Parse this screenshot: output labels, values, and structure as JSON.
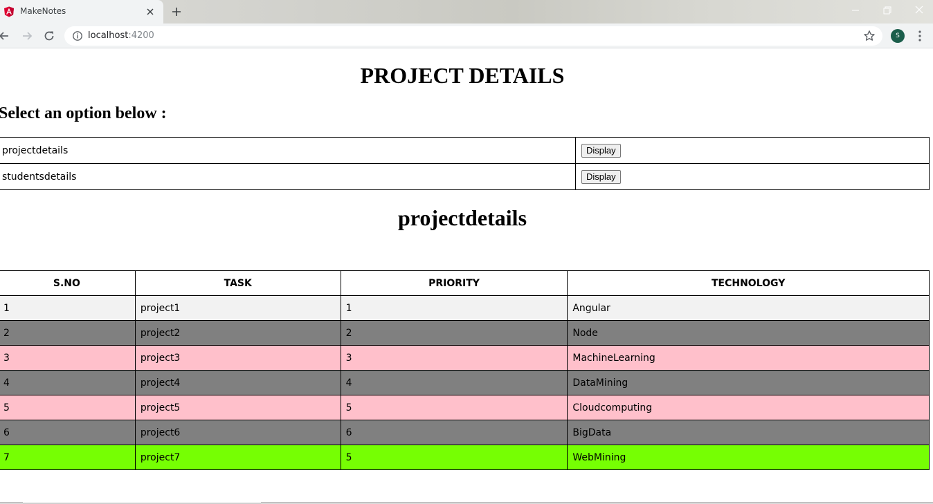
{
  "browser": {
    "tab_title": "MakeNotes",
    "url_host": "localhost",
    "url_port": ":4200",
    "profile_initial": "S"
  },
  "page": {
    "title": "PROJECT DETAILS",
    "select_heading": "Select an option below :",
    "options": [
      {
        "name": "projectdetails",
        "button_label": "Display"
      },
      {
        "name": "studentsdetails",
        "button_label": "Display"
      }
    ],
    "section_title": "projectdetails"
  },
  "table": {
    "headers": [
      "S.NO",
      "TASK",
      "PRIORITY",
      "TECHNOLOGY"
    ],
    "rows": [
      {
        "sno": "1",
        "task": "project1",
        "priority": "1",
        "technology": "Angular",
        "bg": "#f2f2f2"
      },
      {
        "sno": "2",
        "task": "project2",
        "priority": "2",
        "technology": "Node",
        "bg": "#808080"
      },
      {
        "sno": "3",
        "task": "project3",
        "priority": "3",
        "technology": "MachineLearning",
        "bg": "#ffc0cb"
      },
      {
        "sno": "4",
        "task": "project4",
        "priority": "4",
        "technology": "DataMining",
        "bg": "#808080"
      },
      {
        "sno": "5",
        "task": "project5",
        "priority": "5",
        "technology": "Cloudcomputing",
        "bg": "#ffc0cb"
      },
      {
        "sno": "6",
        "task": "project6",
        "priority": "6",
        "technology": "BigData",
        "bg": "#808080"
      },
      {
        "sno": "7",
        "task": "project7",
        "priority": "5",
        "technology": "WebMining",
        "bg": "#76ff03"
      }
    ]
  },
  "colors": {
    "angular_red": "#dd0031",
    "profile_green": "#1b5e4b"
  }
}
